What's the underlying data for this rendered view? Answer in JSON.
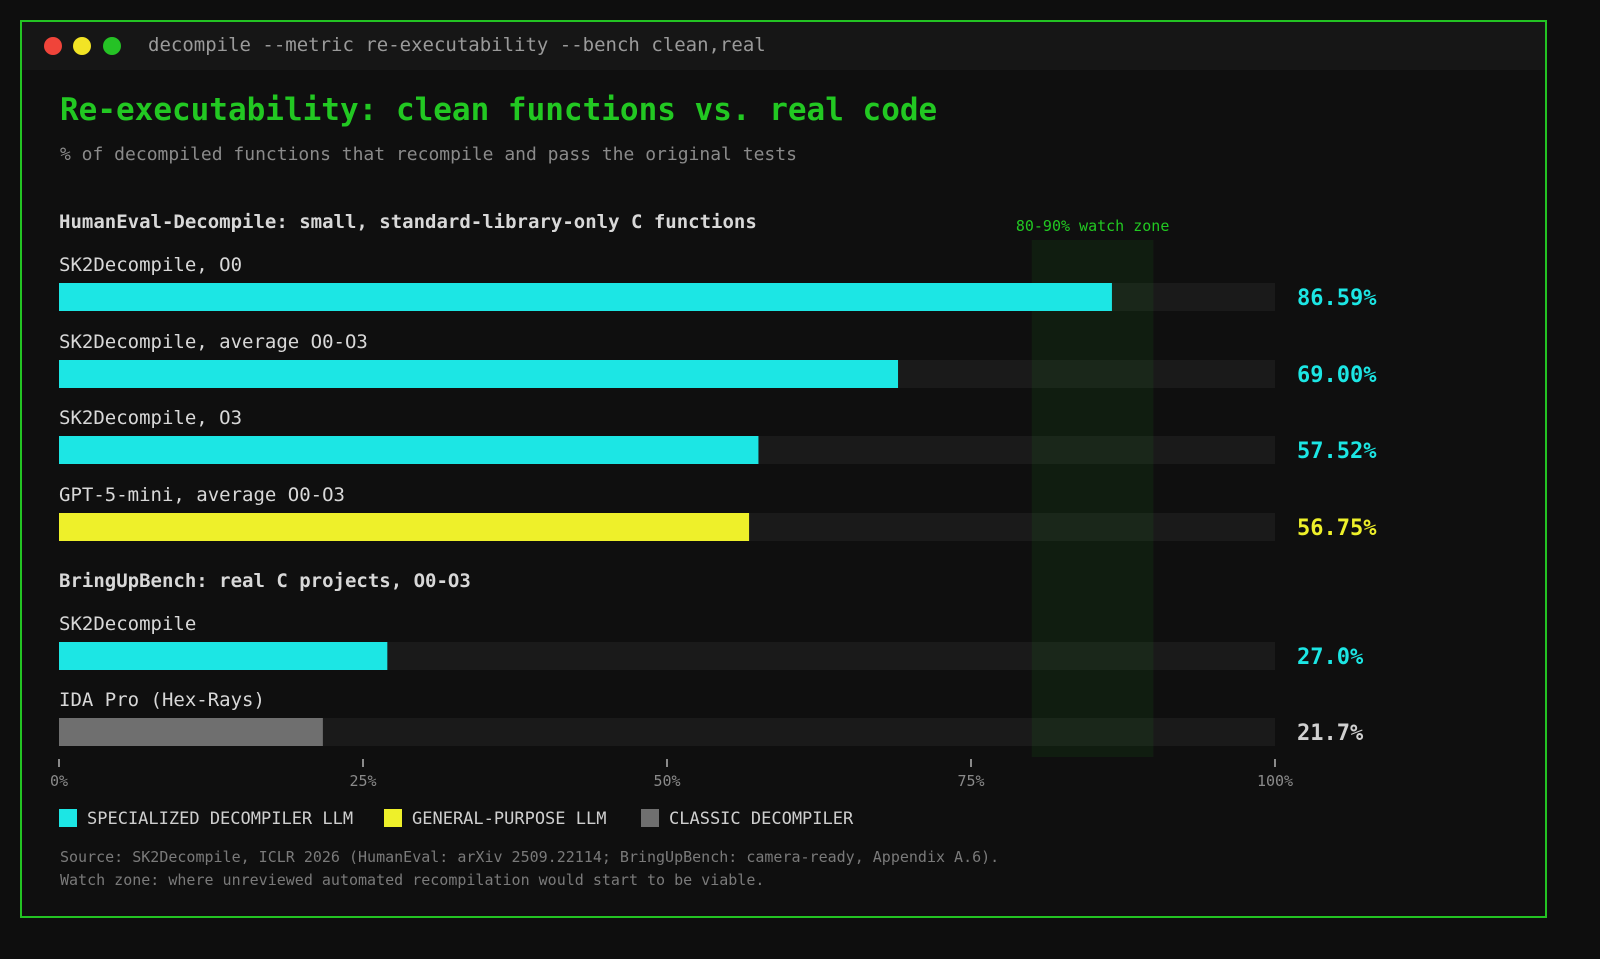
{
  "window": {
    "command": "decompile --metric re-executability --bench clean,real"
  },
  "colors": {
    "accent": "#22c822",
    "specialized": "#1ce6e4",
    "general": "#eef02a",
    "classic": "#6f6f6f",
    "track": "#1a1a1a"
  },
  "chart_data": {
    "type": "bar",
    "orientation": "horizontal",
    "title": "Re-executability: clean functions vs. real code",
    "subtitle": "% of decompiled functions that recompile and pass the original tests",
    "xlim": [
      0,
      100
    ],
    "x_ticks": [
      "0%",
      "25%",
      "50%",
      "75%",
      "100%"
    ],
    "highlight_band": {
      "range": [
        80,
        90
      ],
      "label": "80-90% watch zone"
    },
    "groups": [
      {
        "title": "HumanEval-Decompile: small, standard-library-only C functions",
        "bars": [
          {
            "label": "SK2Decompile, O0",
            "value": 86.59,
            "display": "86.59%",
            "category": "specialized"
          },
          {
            "label": "SK2Decompile, average O0-O3",
            "value": 69.0,
            "display": "69.00%",
            "category": "specialized"
          },
          {
            "label": "SK2Decompile, O3",
            "value": 57.52,
            "display": "57.52%",
            "category": "specialized"
          },
          {
            "label": "GPT-5-mini, average O0-O3",
            "value": 56.75,
            "display": "56.75%",
            "category": "general"
          }
        ]
      },
      {
        "title": "BringUpBench: real C projects, O0-O3",
        "bars": [
          {
            "label": "SK2Decompile",
            "value": 27.0,
            "display": "27.0%",
            "category": "specialized"
          },
          {
            "label": "IDA Pro (Hex-Rays)",
            "value": 21.7,
            "display": "21.7%",
            "category": "classic"
          }
        ]
      }
    ],
    "legend": [
      {
        "key": "specialized",
        "label": "SPECIALIZED DECOMPILER LLM"
      },
      {
        "key": "general",
        "label": "GENERAL-PURPOSE LLM"
      },
      {
        "key": "classic",
        "label": "CLASSIC DECOMPILER"
      }
    ]
  },
  "source": {
    "line1": "Source: SK2Decompile, ICLR 2026 (HumanEval: arXiv 2509.22114; BringUpBench: camera-ready, Appendix A.6).",
    "line2": "Watch zone: where unreviewed automated recompilation would start to be viable."
  }
}
